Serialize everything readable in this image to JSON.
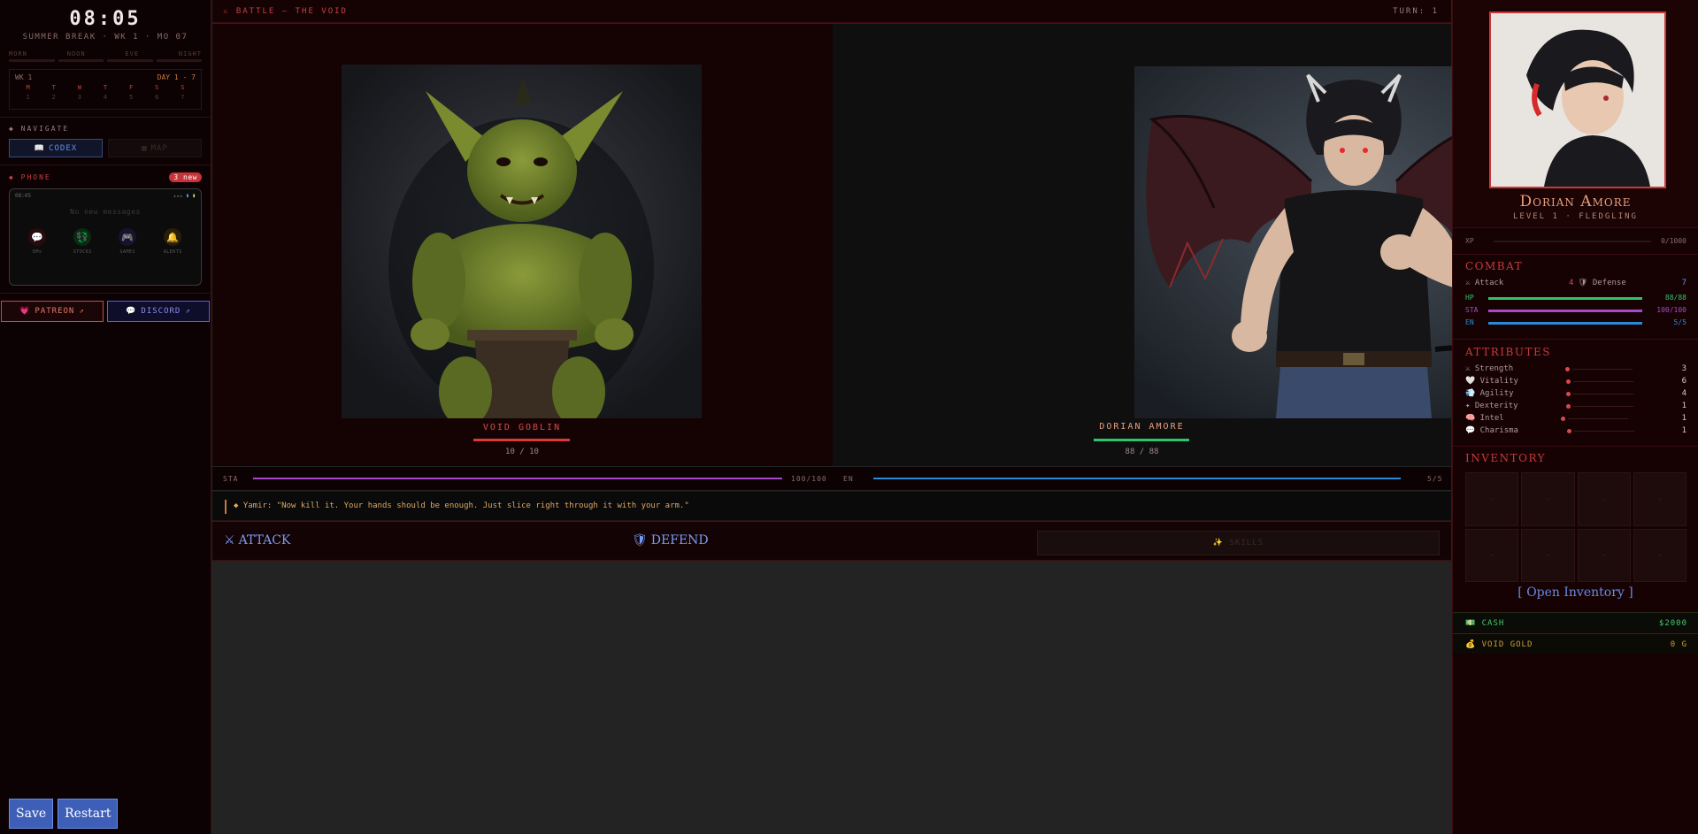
{
  "clock": {
    "time": "08:05",
    "sub": "SUMMER BREAK · WK 1 · MO 07"
  },
  "timeofday": [
    "MORN",
    "NOON",
    "EVE",
    "NIGHT"
  ],
  "week": {
    "label": "WK 1",
    "range": "DAY 1 - 7",
    "days": [
      "M",
      "T",
      "W",
      "T",
      "F",
      "S",
      "S"
    ],
    "nums": [
      "1",
      "2",
      "3",
      "4",
      "5",
      "6",
      "7"
    ]
  },
  "navigate": {
    "heading": "◆ NAVIGATE",
    "codex": "CODEX",
    "map": "MAP"
  },
  "phone": {
    "heading": "◆ PHONE",
    "badge": "3 new",
    "time": "08:05",
    "signal": "▴▴▴",
    "nomsg": "No new messages",
    "apps": [
      {
        "icon": "💬",
        "label": "DMs",
        "bg": "#2a0a0c"
      },
      {
        "icon": "💱",
        "label": "STOCKS",
        "bg": "#0a2a12"
      },
      {
        "icon": "🎮",
        "label": "GAMES",
        "bg": "#1a1030"
      },
      {
        "icon": "🔔",
        "label": "ALERTS",
        "bg": "#2a1e06"
      }
    ]
  },
  "social": {
    "patreon": "PATREON",
    "discord": "DISCORD"
  },
  "buttons": {
    "save": "Save",
    "restart": "Restart"
  },
  "battle": {
    "title": "⚔ BATTLE — THE VOID",
    "turn": "TURN: 1"
  },
  "enemy": {
    "name": "VOID GOBLIN",
    "hp_text": "10 / 10",
    "hp_fraction": 1.0
  },
  "player": {
    "name": "DORIAN AMORE",
    "hp_text": "88 / 88",
    "hp_fraction": 1.0
  },
  "resources": {
    "sta_label": "STA",
    "sta_value": "100/100",
    "en_label": "EN",
    "en_value": "5/5"
  },
  "dialog": {
    "text": "◆ Yamir: \"Now kill it. Your hands should be enough. Just slice right through it with your arm.\""
  },
  "actions": {
    "attack": "ATTACK",
    "defend": "DEFEND",
    "skills": "✨ SKILLS"
  },
  "profile": {
    "name": "Dorian Amore",
    "level": "LEVEL 1 · FLEDGLING",
    "xp_label": "XP",
    "xp_value": "0/1000"
  },
  "combat": {
    "heading": "COMBAT",
    "attack_label": "⚔ Attack",
    "attack_value": "4",
    "defense_label": "🛡 Defense",
    "defense_value": "7",
    "bars": [
      {
        "label": "HP",
        "value": "88/88",
        "color": "#2ec56a",
        "fill": 1.0
      },
      {
        "label": "STA",
        "value": "100/100",
        "color": "#a84ac8",
        "fill": 1.0
      },
      {
        "label": "EN",
        "value": "5/5",
        "color": "#2a8ad8",
        "fill": 1.0
      }
    ]
  },
  "attributes": {
    "heading": "ATTRIBUTES",
    "items": [
      {
        "label": "⚔ Strength",
        "value": "3"
      },
      {
        "label": "🤍 Vitality",
        "value": "6"
      },
      {
        "label": "💨 Agility",
        "value": "4"
      },
      {
        "label": "✦ Dexterity",
        "value": "1"
      },
      {
        "label": "🧠 Intel",
        "value": "1"
      },
      {
        "label": "💬 Charisma",
        "value": "1"
      }
    ]
  },
  "inventory": {
    "heading": "INVENTORY",
    "slots": [
      "-",
      "-",
      "-",
      "-",
      "-",
      "-",
      "-",
      "-"
    ],
    "open": "[ Open Inventory ]"
  },
  "currency": {
    "cash_label": "💵 CASH",
    "cash_value": "$2000",
    "gold_label": "💰 VOID GOLD",
    "gold_value": "0 G"
  },
  "colors": {
    "accent_red": "#c83a3a",
    "link_blue": "#6a8ae8",
    "gold": "#c87a3a"
  }
}
